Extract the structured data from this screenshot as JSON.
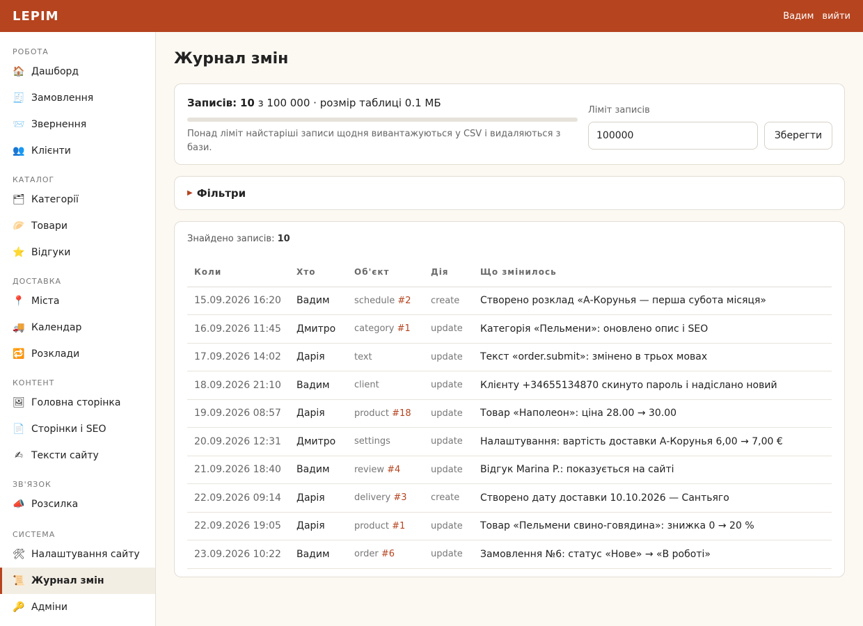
{
  "header": {
    "brand": "LEPIM",
    "user": "Вадим",
    "logout": "вийти"
  },
  "sidebar": {
    "sections": [
      {
        "title": "Робота",
        "items": [
          {
            "icon": "🏠",
            "icon_name": "home-icon",
            "label": "Дашборд"
          },
          {
            "icon": "🧾",
            "icon_name": "receipt-icon",
            "label": "Замовлення"
          },
          {
            "icon": "📨",
            "icon_name": "envelope-icon",
            "label": "Звернення"
          },
          {
            "icon": "👥",
            "icon_name": "users-icon",
            "label": "Клієнти"
          }
        ]
      },
      {
        "title": "Каталог",
        "items": [
          {
            "icon": "🗂",
            "icon_name": "folders-icon",
            "label": "Категорії"
          },
          {
            "icon": "🥟",
            "icon_name": "dumpling-icon",
            "label": "Товари"
          },
          {
            "icon": "⭐",
            "icon_name": "star-icon",
            "label": "Відгуки"
          }
        ]
      },
      {
        "title": "Доставка",
        "items": [
          {
            "icon": "📍",
            "icon_name": "pin-icon",
            "label": "Міста"
          },
          {
            "icon": "🚚",
            "icon_name": "truck-icon",
            "label": "Календар"
          },
          {
            "icon": "🔁",
            "icon_name": "repeat-icon",
            "label": "Розклади"
          }
        ]
      },
      {
        "title": "Контент",
        "items": [
          {
            "icon": "🖼",
            "icon_name": "picture-icon",
            "label": "Головна сторінка"
          },
          {
            "icon": "📄",
            "icon_name": "page-icon",
            "label": "Сторінки і SEO"
          },
          {
            "icon": "✍",
            "icon_name": "writing-icon",
            "label": "Тексти сайту"
          }
        ]
      },
      {
        "title": "Зв'язок",
        "items": [
          {
            "icon": "📣",
            "icon_name": "megaphone-icon",
            "label": "Розсилка"
          }
        ]
      },
      {
        "title": "Система",
        "items": [
          {
            "icon": "🛠",
            "icon_name": "tools-icon",
            "label": "Налаштування сайту"
          },
          {
            "icon": "📜",
            "icon_name": "scroll-icon",
            "label": "Журнал змін",
            "active": true
          },
          {
            "icon": "🔑",
            "icon_name": "key-icon",
            "label": "Адміни"
          }
        ]
      }
    ]
  },
  "page": {
    "title": "Журнал змін"
  },
  "limit": {
    "count_label": "Записів:",
    "count": "10",
    "of_text": "з 100 000 · розмір таблиці 0.1 МБ",
    "progress": 0.0001,
    "note": "Понад ліміт найстаріші записи щодня вивантажуються у CSV і видаляються з бази.",
    "field_label": "Ліміт записів",
    "field_value": "100000",
    "save_label": "Зберегти"
  },
  "filters": {
    "label": "Фільтри"
  },
  "log": {
    "found_label": "Знайдено записів:",
    "found_count": "10",
    "columns": [
      "Коли",
      "Хто",
      "Об'єкт",
      "Дія",
      "Що змінилось"
    ],
    "rows": [
      {
        "when": "15.09.2026 16:20",
        "who": "Вадим",
        "obj": "schedule",
        "id": "#2",
        "action": "create",
        "what": "Створено розклад «А-Корунья — перша субота місяця»"
      },
      {
        "when": "16.09.2026 11:45",
        "who": "Дмитро",
        "obj": "category",
        "id": "#1",
        "action": "update",
        "what": "Категорія «Пельмени»: оновлено опис і SEO"
      },
      {
        "when": "17.09.2026 14:02",
        "who": "Дарія",
        "obj": "text",
        "id": "",
        "action": "update",
        "what": "Текст «order.submit»: змінено в трьох мовах"
      },
      {
        "when": "18.09.2026 21:10",
        "who": "Вадим",
        "obj": "client",
        "id": "",
        "action": "update",
        "what": "Клієнту +34655134870 скинуто пароль і надіслано новий"
      },
      {
        "when": "19.09.2026 08:57",
        "who": "Дарія",
        "obj": "product",
        "id": "#18",
        "action": "update",
        "what": "Товар «Наполеон»: ціна 28.00 → 30.00"
      },
      {
        "when": "20.09.2026 12:31",
        "who": "Дмитро",
        "obj": "settings",
        "id": "",
        "action": "update",
        "what": "Налаштування: вартість доставки А-Корунья 6,00 → 7,00 €"
      },
      {
        "when": "21.09.2026 18:40",
        "who": "Вадим",
        "obj": "review",
        "id": "#4",
        "action": "update",
        "what": "Відгук Marina P.: показується на сайті"
      },
      {
        "when": "22.09.2026 09:14",
        "who": "Дарія",
        "obj": "delivery",
        "id": "#3",
        "action": "create",
        "what": "Створено дату доставки 10.10.2026 — Сантьяго"
      },
      {
        "when": "22.09.2026 19:05",
        "who": "Дарія",
        "obj": "product",
        "id": "#1",
        "action": "update",
        "what": "Товар «Пельмени свино-говядина»: знижка 0 → 20 %"
      },
      {
        "when": "23.09.2026 10:22",
        "who": "Вадим",
        "obj": "order",
        "id": "#6",
        "action": "update",
        "what": "Замовлення №6: статус «Нове» → «В роботі»"
      }
    ]
  },
  "colors": {
    "accent": "#b5441f",
    "background": "#fcf9f3"
  }
}
